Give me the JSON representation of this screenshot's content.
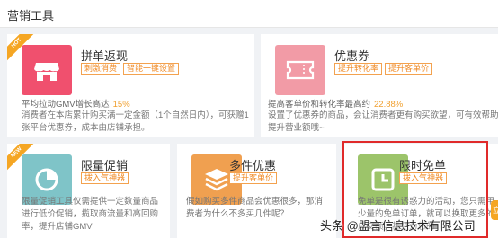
{
  "header": {
    "title": "营销工具"
  },
  "cards": {
    "pindan": {
      "badge": "HOT",
      "title": "拼单返现",
      "tags": [
        "刺激消费",
        "智能一键设置"
      ],
      "stat_label": "平均拉动GMV增长高达",
      "stat_value": "15%",
      "desc": "消费者在本店累计购买满一定金额（1个自然日内），可获赠1张平台优惠券，成本由店铺承担。",
      "color": "#f0506e"
    },
    "coupon": {
      "title": "优惠券",
      "tags": [
        "提升转化率",
        "提升客单价"
      ],
      "stat_label": "提高客单价和转化率最高约",
      "stat_value": "22.88%",
      "desc": "设置了优惠券的商品，会让消费者更有购买欲望，可有效帮助提升营业额哦~",
      "color": "#f29ba6"
    },
    "flash": {
      "badge": "NEW",
      "title": "限量促销",
      "tags": [
        "拨入气神器"
      ],
      "desc": "限量促销工具仅需提供一定数量商品进行低价促销，揽取商流量和高回购率，提升店铺GMV",
      "color": "#7fc4c8"
    },
    "multi": {
      "title": "多件优惠",
      "tags": [
        "提升客单价"
      ],
      "desc": "假如购买多件商品会优惠很多，那消费者为什么不多买几件呢？",
      "color": "#f0a050"
    },
    "free": {
      "title": "限时免单",
      "tags": [
        "拨入气神器"
      ],
      "desc": "免单是很有诱惑力的活动，您只需用少量的免单订单，就可以换取更多的成交额，甚至为您的",
      "color": "#9cc46a"
    }
  },
  "watermark": "头条 @盟言信息技术有限公司",
  "side_button": "立"
}
